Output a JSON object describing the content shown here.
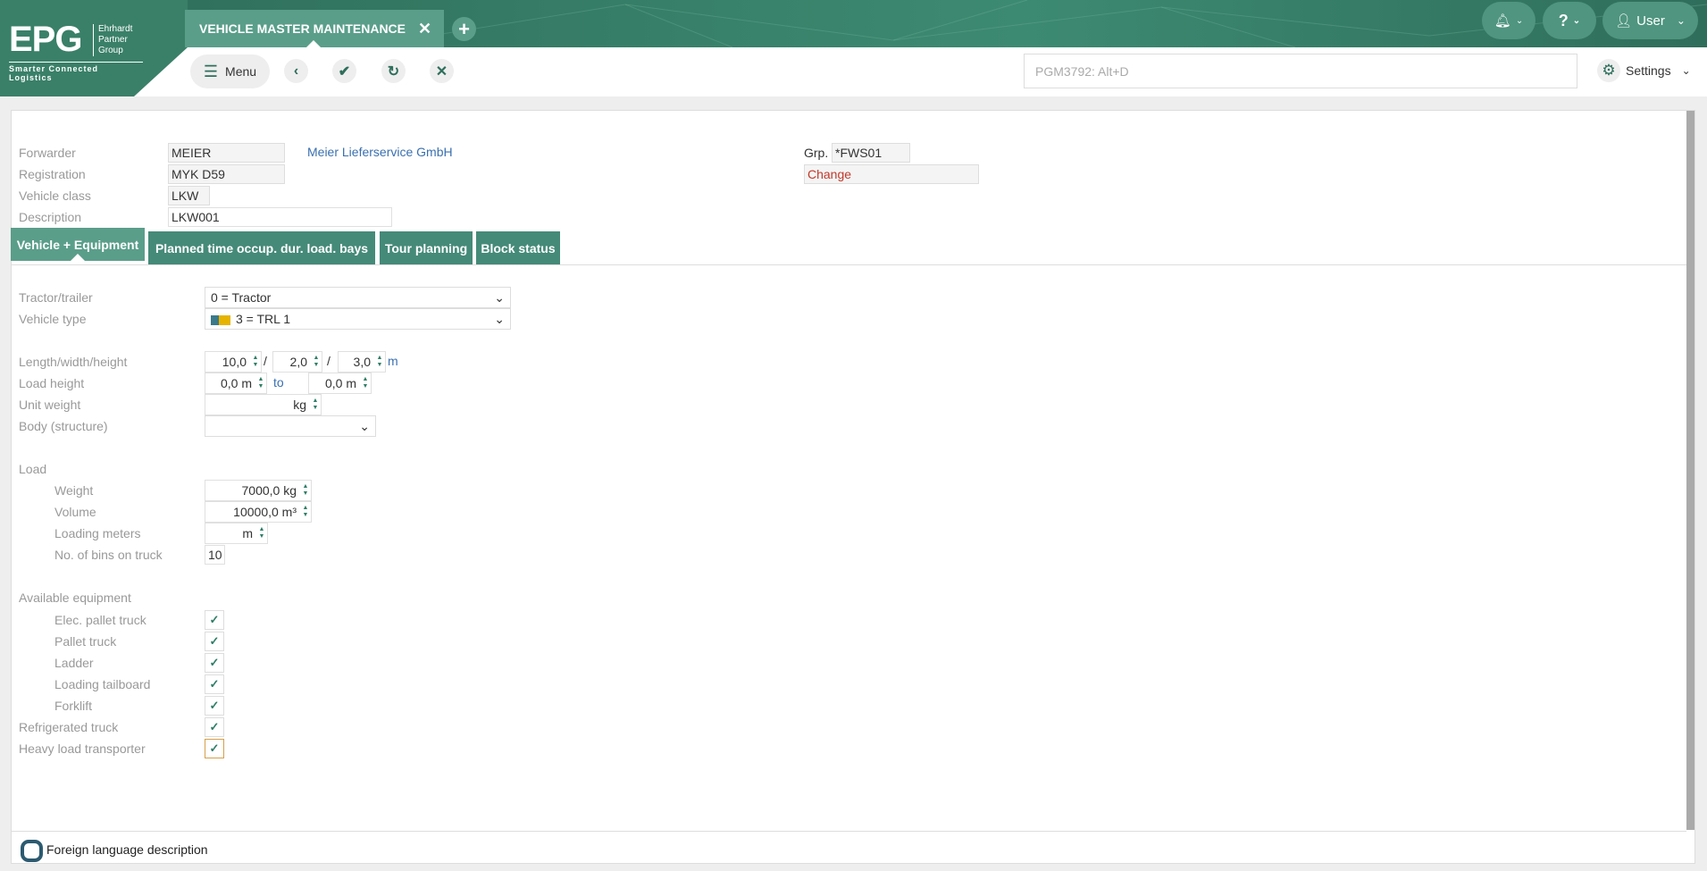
{
  "header": {
    "logo": {
      "mark": "EPG",
      "name_lines": [
        "Ehrhardt",
        "Partner",
        "Group"
      ],
      "tagline": "Smarter Connected Logistics"
    },
    "app_tab": {
      "title": "VEHICLE MASTER MAINTENANCE",
      "close_icon": "close-icon"
    },
    "add_tab_icon": "plus-icon",
    "notifications_icon": "bell-icon",
    "help_label": "?",
    "user_label": "User"
  },
  "toolbar": {
    "menu_label": "Menu",
    "search_placeholder": "PGM3792: Alt+D",
    "settings_label": "Settings",
    "actions": [
      "back-icon",
      "confirm-icon",
      "refresh-icon",
      "cancel-icon"
    ]
  },
  "form": {
    "forwarder": {
      "label": "Forwarder",
      "value": "MEIER",
      "name": "Meier Lieferservice GmbH"
    },
    "registration": {
      "label": "Registration",
      "value": "MYK D59"
    },
    "vehicle_class": {
      "label": "Vehicle class",
      "value": "LKW"
    },
    "description": {
      "label": "Description",
      "value": "LKW001"
    },
    "group": {
      "label": "Grp.",
      "value": "*FWS01"
    },
    "mode": "Change"
  },
  "tabs": [
    {
      "label": "Vehicle + Equipment",
      "active": true
    },
    {
      "label": "Planned time occup. dur. load. bays"
    },
    {
      "label": "Tour planning"
    },
    {
      "label": "Block status"
    }
  ],
  "vehicle": {
    "tractor_trailer": {
      "label": "Tractor/trailer",
      "value": "0 = Tractor"
    },
    "vehicle_type": {
      "label": "Vehicle type",
      "value": "3 = TRL 1",
      "icon": "truck-icon"
    },
    "dimensions": {
      "label": "Length/width/height",
      "length": "10,0",
      "width": "2,0",
      "height": "3,0",
      "sep": "/",
      "unit": "m"
    },
    "load_height": {
      "label": "Load height",
      "from": "0,0 m",
      "to_label": "to",
      "to": "0,0 m"
    },
    "unit_weight": {
      "label": "Unit weight",
      "unit": "kg"
    },
    "body": {
      "label": "Body (structure)",
      "value": ""
    },
    "load": {
      "label": "Load",
      "weight": {
        "label": "Weight",
        "value": "7000,0 kg"
      },
      "volume": {
        "label": "Volume",
        "value": "10000,0 m³"
      },
      "loading_meters": {
        "label": "Loading meters",
        "value": "m"
      },
      "bins": {
        "label": "No. of bins on truck",
        "value": "10"
      }
    },
    "equipment": {
      "label": "Available equipment",
      "items": [
        {
          "label": "Elec. pallet truck",
          "checked": true
        },
        {
          "label": "Pallet truck",
          "checked": true
        },
        {
          "label": "Ladder",
          "checked": true
        },
        {
          "label": "Loading tailboard",
          "checked": true
        },
        {
          "label": "Forklift",
          "checked": true
        },
        {
          "label": "Refrigerated truck",
          "checked": true
        },
        {
          "label": "Heavy load transporter",
          "checked": true
        }
      ]
    }
  },
  "footer": {
    "foreign_language_label": "Foreign language description",
    "checked": false
  },
  "colors": {
    "brand_green": "#3d8a72",
    "tab_green": "#458a78",
    "active_tab": "#5a9e8a",
    "mode_red": "#c0392b",
    "focus_orange": "#d4a04a"
  }
}
